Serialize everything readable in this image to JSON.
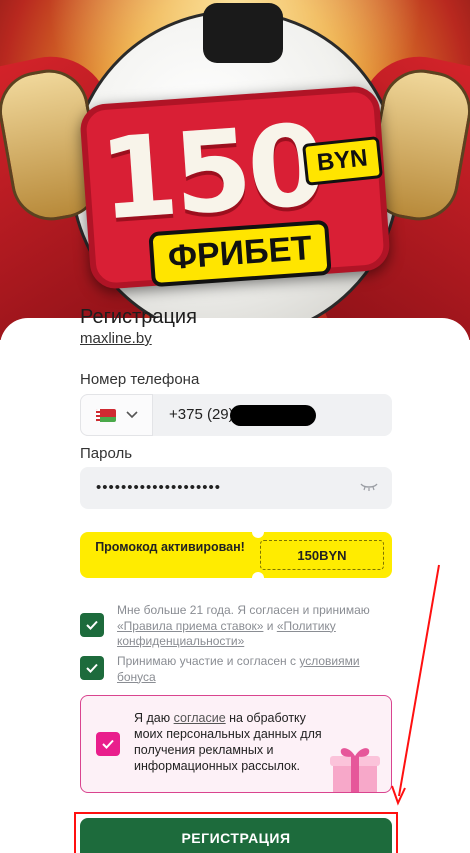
{
  "banner": {
    "amount": "150",
    "currency": "BYN",
    "freebet": "ФРИБЕТ"
  },
  "form": {
    "title": "Регистрация",
    "site": "maxline.by",
    "phone_label": "Номер телефона",
    "phone_prefix": "+375 (29)",
    "password_label": "Пароль",
    "password_value": "••••••••••••••••••••",
    "promo_status": "Промокод активирован!",
    "promo_code": "150BYN",
    "age_text": "Мне больше 21 года. Я согласен и принимаю",
    "rules_link": "«Правила приема ставок»",
    "and_text": "и",
    "privacy_link": "«Политику конфиденциальности»",
    "bonus_text": "Принимаю участие и согласен с",
    "bonus_link": "условиями бонуса",
    "consent_prefix": "Я даю",
    "consent_link": "согласие",
    "consent_rest": "на обработку моих персональных данных для получения рекламных и информационных рассылок.",
    "submit_label": "РЕГИСТРАЦИЯ"
  },
  "colors": {
    "primary_green": "#1d6b3c",
    "promo_yellow": "#ffec00",
    "consent_pink": "#e91e8c",
    "annotation_red": "#ff1010"
  },
  "icons": {
    "flag": "belarus-flag-icon",
    "country_chevron": "chevron-down-icon",
    "password_toggle": "eye-closed-icon",
    "checkbox": "check-icon",
    "gift": "gift-box-icon"
  }
}
